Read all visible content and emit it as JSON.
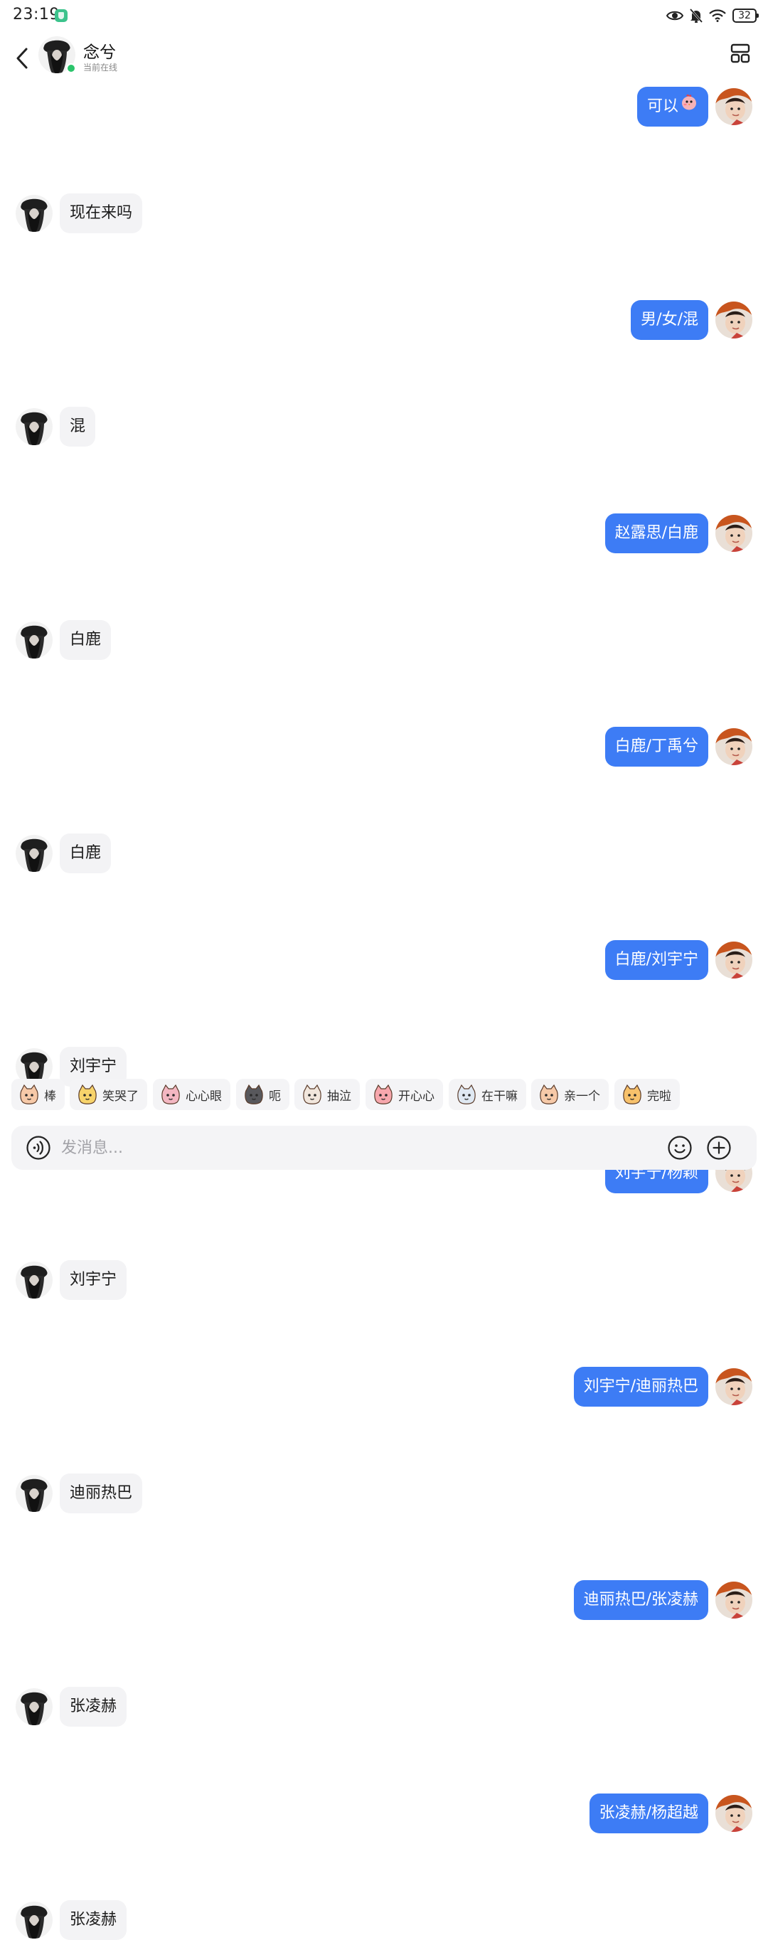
{
  "status_bar": {
    "time": "23:19",
    "battery": "32",
    "icons": [
      "app-shield-icon",
      "eye-icon",
      "mute-bell-icon",
      "wifi-icon",
      "battery-icon"
    ]
  },
  "header": {
    "name": "念兮",
    "status": "当前在线",
    "icons": [
      "back-arrow-icon",
      "layout-grid-icon"
    ]
  },
  "messages": [
    {
      "sender": "me",
      "text": "可以",
      "sticker": "chick-sticker"
    },
    {
      "sender": "them",
      "text": "现在来吗"
    },
    {
      "sender": "me",
      "text": "男/女/混"
    },
    {
      "sender": "them",
      "text": "混"
    },
    {
      "sender": "me",
      "text": "赵露思/白鹿"
    },
    {
      "sender": "them",
      "text": "白鹿"
    },
    {
      "sender": "me",
      "text": "白鹿/丁禹兮"
    },
    {
      "sender": "them",
      "text": "白鹿"
    },
    {
      "sender": "me",
      "text": "白鹿/刘宇宁"
    },
    {
      "sender": "them",
      "text": "刘宇宁"
    },
    {
      "sender": "me",
      "text": "刘宇宁/杨颖"
    },
    {
      "sender": "them",
      "text": "刘宇宁"
    },
    {
      "sender": "me",
      "text": "刘宇宁/迪丽热巴"
    },
    {
      "sender": "them",
      "text": "迪丽热巴"
    },
    {
      "sender": "me",
      "text": "迪丽热巴/张凌赫"
    },
    {
      "sender": "them",
      "text": "张凌赫"
    },
    {
      "sender": "me",
      "text": "张凌赫/杨超越"
    },
    {
      "sender": "them",
      "text": "张凌赫"
    }
  ],
  "emoji_suggestions": [
    {
      "label": "棒",
      "icon": "cat-thumbs-up-icon"
    },
    {
      "label": "笑哭了",
      "icon": "cat-laugh-cry-icon"
    },
    {
      "label": "心心眼",
      "icon": "cat-heart-eyes-icon"
    },
    {
      "label": "呃",
      "icon": "cat-speechless-icon"
    },
    {
      "label": "抽泣",
      "icon": "cat-sob-icon"
    },
    {
      "label": "开心心",
      "icon": "cat-happy-heart-icon"
    },
    {
      "label": "在干嘛",
      "icon": "cat-wondering-icon"
    },
    {
      "label": "亲一个",
      "icon": "cat-kiss-icon"
    },
    {
      "label": "完啦",
      "icon": "cat-done-icon"
    }
  ],
  "input": {
    "placeholder": "发消息...",
    "value": "",
    "icons": [
      "voice-icon",
      "emoji-icon",
      "plus-icon"
    ]
  },
  "colors": {
    "my_bubble": "#3d7cf5",
    "their_bubble": "#f3f3f5",
    "online": "#2bc46b"
  }
}
